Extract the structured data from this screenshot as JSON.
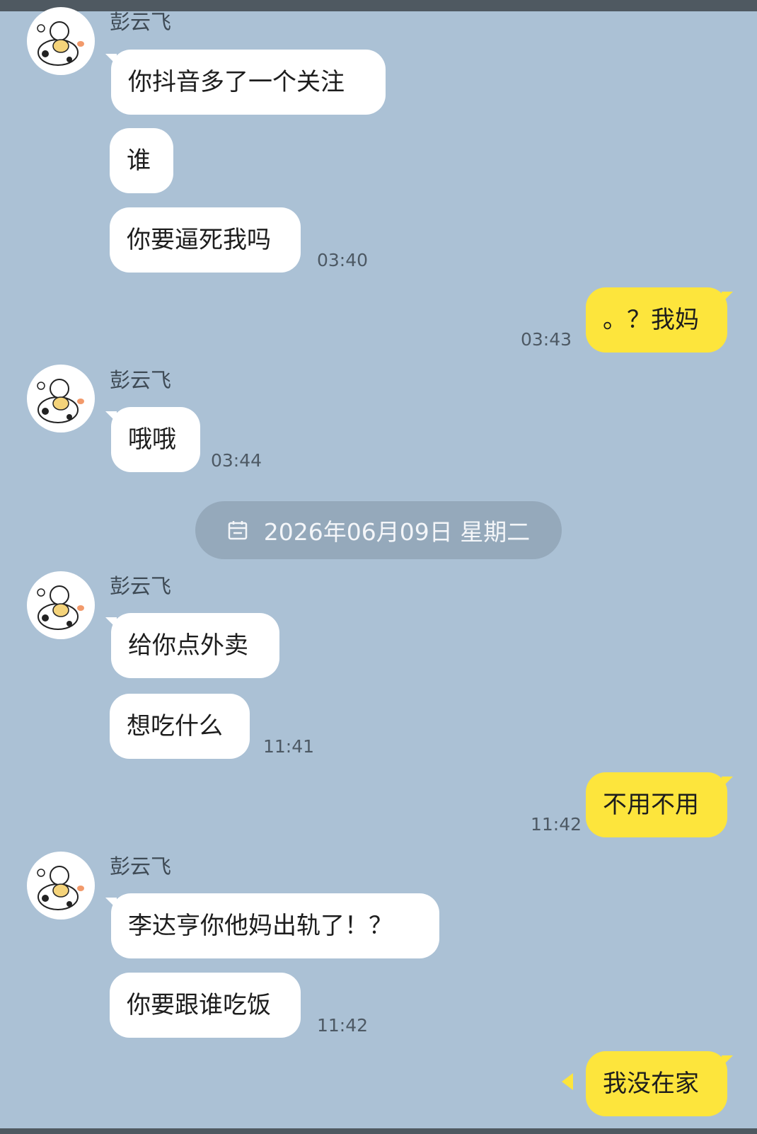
{
  "contact": {
    "name": "彭云飞"
  },
  "messages": {
    "m1": "你抖音多了一个关注",
    "m2": "谁",
    "m3": "你要逼死我吗",
    "m3_time": "03:40",
    "m4": "。？我妈",
    "m4_time": "03:43",
    "m5": "哦哦",
    "m5_time": "03:44",
    "m6": "给你点外卖",
    "m7": "想吃什么",
    "m7_time": "11:41",
    "m8": "不用不用",
    "m8_time": "11:42",
    "m9": "李达亨你他妈出轨了！？",
    "m10": "你要跟谁吃饭",
    "m10_time": "11:42",
    "m11": "我没在家"
  },
  "date_divider": "2026年06月09日 星期二",
  "icons": {
    "avatar": "cartoon-cow-avatar-icon",
    "date": "calendar-icon",
    "sending": "send-indicator-icon"
  },
  "colors": {
    "background": "#abc1d5",
    "incoming_bubble": "#ffffff",
    "outgoing_bubble": "#fde53c",
    "date_pill": "#95a9bb"
  }
}
